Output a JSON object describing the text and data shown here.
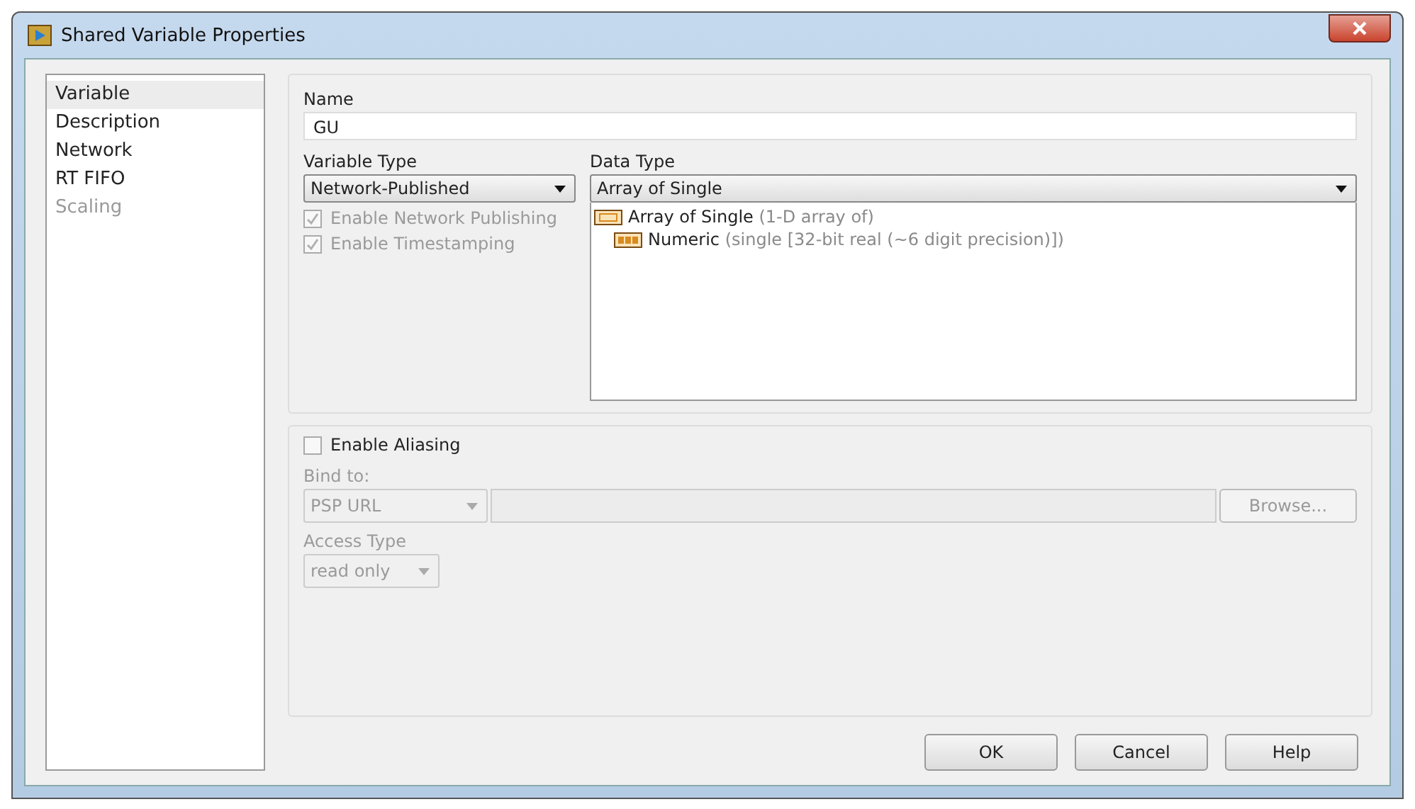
{
  "window": {
    "title": "Shared Variable Properties"
  },
  "sidebar": {
    "items": [
      {
        "label": "Variable",
        "selected": true,
        "disabled": false
      },
      {
        "label": "Description",
        "selected": false,
        "disabled": false
      },
      {
        "label": "Network",
        "selected": false,
        "disabled": false
      },
      {
        "label": "RT FIFO",
        "selected": false,
        "disabled": false
      },
      {
        "label": "Scaling",
        "selected": false,
        "disabled": true
      }
    ]
  },
  "name": {
    "label": "Name",
    "value": "GU"
  },
  "variable_type": {
    "label": "Variable Type",
    "value": "Network-Published",
    "disabled": false
  },
  "options": [
    {
      "label": "Enable Network Publishing",
      "checked": true,
      "disabled": true
    },
    {
      "label": "Enable Timestamping",
      "checked": true,
      "disabled": true
    }
  ],
  "data_type": {
    "label": "Data Type",
    "value": "Array of Single",
    "tree": [
      {
        "name": "Array of Single",
        "detail": "(1-D array of)",
        "kind": "array",
        "children": [
          {
            "name": "Numeric",
            "detail": "(single [32-bit real (~6 digit precision)])",
            "kind": "numeric"
          }
        ]
      }
    ]
  },
  "aliasing": {
    "label": "Enable Aliasing",
    "checked": false,
    "bind_label": "Bind to:",
    "bind_select": "PSP URL",
    "browse": "Browse...",
    "access_label": "Access Type",
    "access_select": "read only",
    "disabled": true
  },
  "buttons": [
    "OK",
    "Cancel",
    "Help"
  ]
}
